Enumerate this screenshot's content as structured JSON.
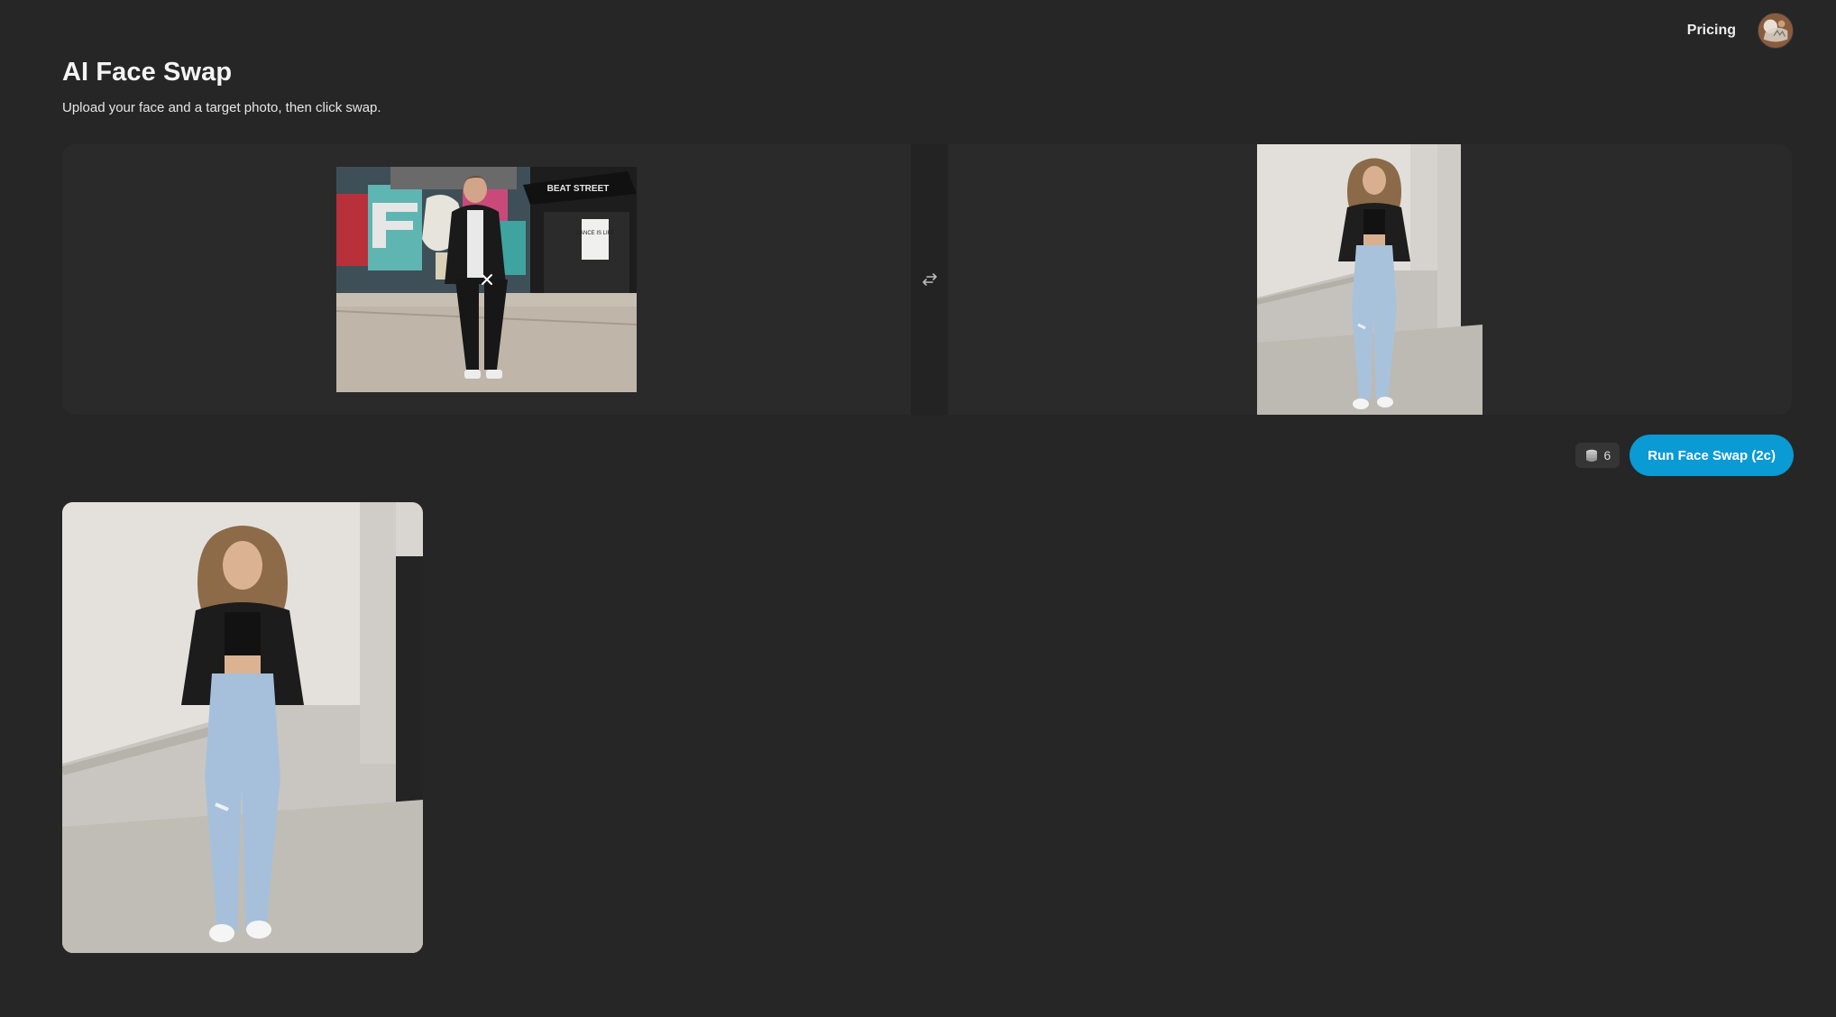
{
  "nav": {
    "pricing_label": "Pricing"
  },
  "header": {
    "title": "AI Face Swap",
    "subtitle": "Upload your face and a target photo, then click swap."
  },
  "face_photo": {
    "sign_text": "BEAT STREET",
    "poster_text": "DANCE IS LIFE"
  },
  "actions": {
    "credits": "6",
    "run_label": "Run Face Swap (2c)"
  },
  "colors": {
    "background": "#262626",
    "panel": "#2a2a2a",
    "accent": "#0a9ad4"
  },
  "icons": {
    "swap": "swap-arrows-icon",
    "remove": "close-icon",
    "credits": "coins-stack-icon"
  }
}
